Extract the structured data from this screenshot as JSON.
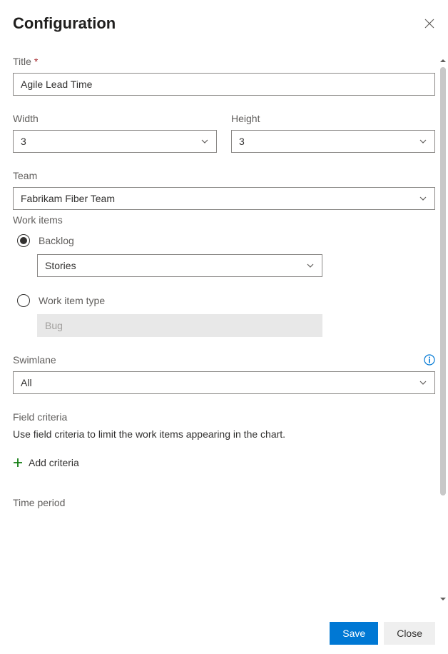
{
  "header": {
    "title": "Configuration"
  },
  "fields": {
    "title": {
      "label": "Title",
      "required": "*",
      "value": "Agile Lead Time"
    },
    "width": {
      "label": "Width",
      "value": "3"
    },
    "height": {
      "label": "Height",
      "value": "3"
    },
    "team": {
      "label": "Team",
      "value": "Fabrikam Fiber Team"
    },
    "work_items": {
      "label": "Work items"
    },
    "backlog": {
      "label": "Backlog",
      "value": "Stories"
    },
    "work_item_type": {
      "label": "Work item type",
      "value": "Bug"
    },
    "swimlane": {
      "label": "Swimlane",
      "value": "All"
    },
    "field_criteria": {
      "label": "Field criteria",
      "help": "Use field criteria to limit the work items appearing in the chart."
    },
    "add_criteria": {
      "label": "Add criteria"
    },
    "time_period": {
      "label": "Time period"
    }
  },
  "footer": {
    "save": "Save",
    "close": "Close"
  }
}
